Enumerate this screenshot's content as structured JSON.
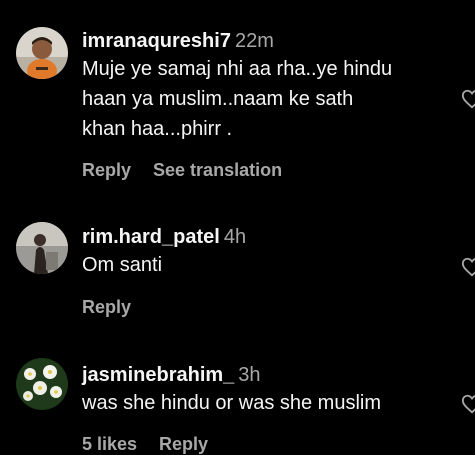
{
  "comments": [
    {
      "username": "imranaqureshi7",
      "time": "22m",
      "lines": [
        "Muje ye samaj nhi aa rha..ye hindu",
        "haan ya muslim..naam ke sath",
        "khan haa...phirr ."
      ],
      "reply": "Reply",
      "translation": "See translation",
      "avatar_icon": "child-orange-shirt-avatar"
    },
    {
      "username": "rim.hard_patel",
      "time": "4h",
      "lines": [
        "Om santi"
      ],
      "reply": "Reply",
      "avatar_icon": "person-photo-avatar"
    },
    {
      "username": "jasminebrahim_",
      "time": "3h",
      "lines": [
        "was she hindu or was she muslim"
      ],
      "likes": "5 likes",
      "reply": "Reply",
      "avatar_icon": "white-flowers-avatar"
    }
  ],
  "colors": {
    "background": "#000000",
    "primary_text": "#f5f5f5",
    "secondary_text": "#a8a8a8"
  }
}
